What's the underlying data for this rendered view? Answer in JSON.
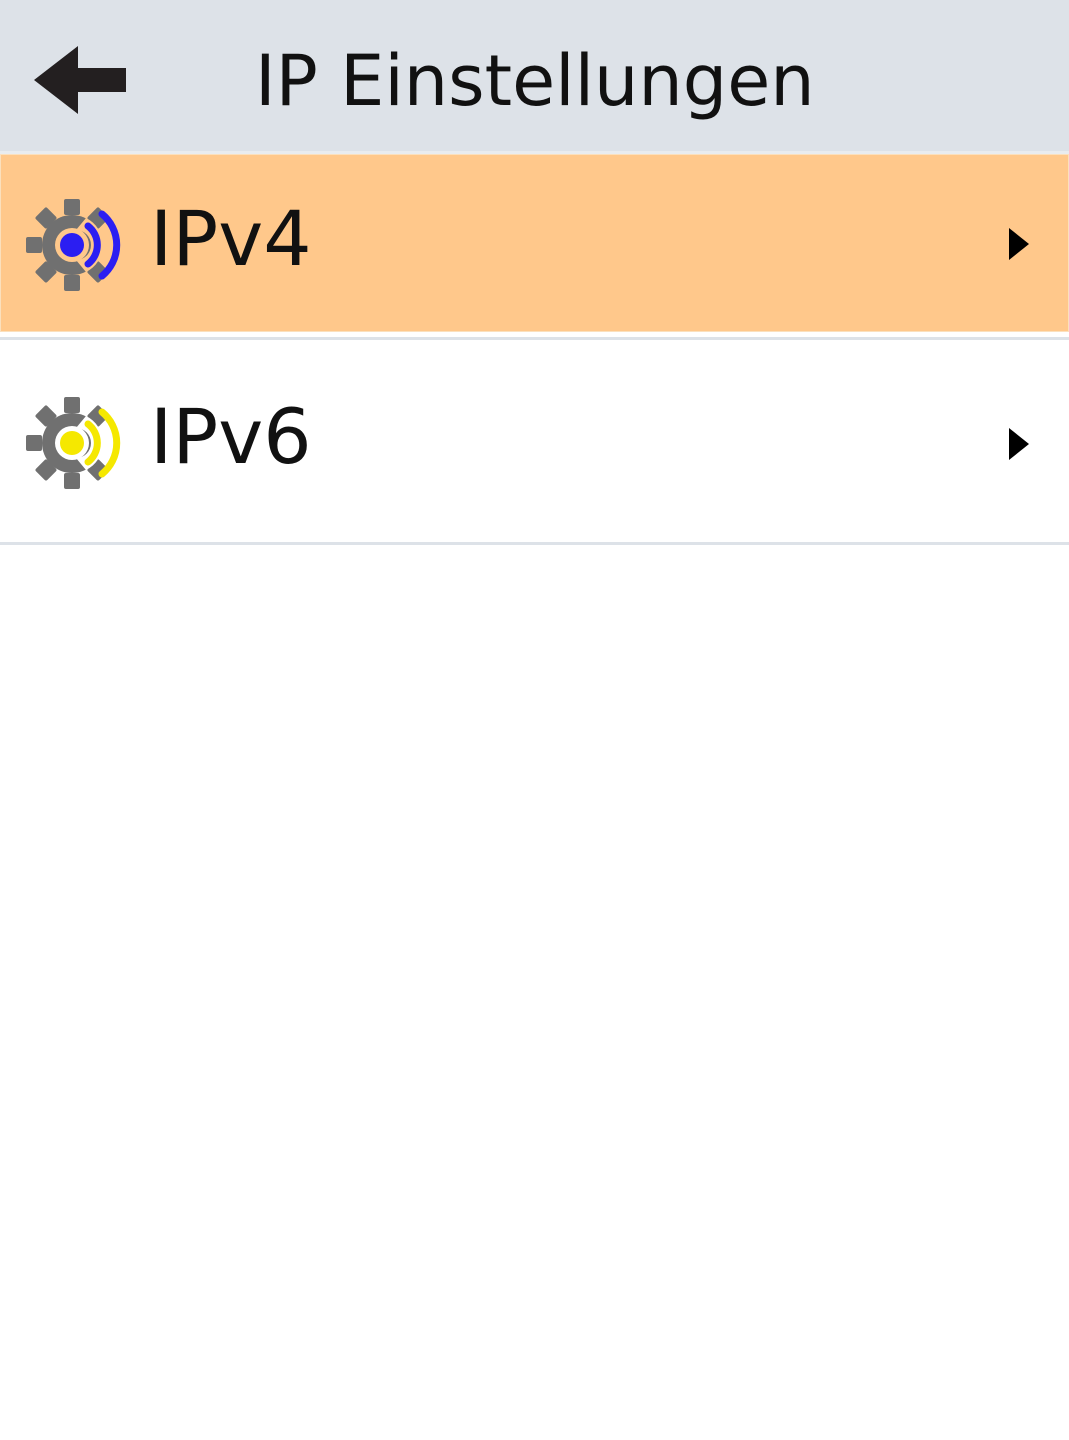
{
  "header": {
    "title": "IP Einstellungen",
    "back_icon": "arrow-left-icon"
  },
  "items": [
    {
      "label": "IPv4",
      "icon": "gear-wireless-icon",
      "accent_color": "#2b1ef2",
      "selected": true,
      "chevron_icon": "chevron-right-icon"
    },
    {
      "label": "IPv6",
      "icon": "gear-wireless-icon",
      "accent_color": "#f5e800",
      "selected": false,
      "chevron_icon": "chevron-right-icon"
    }
  ],
  "colors": {
    "header_bg": "#dde2e8",
    "selected_bg": "#ffc88b",
    "gear": "#707070"
  }
}
